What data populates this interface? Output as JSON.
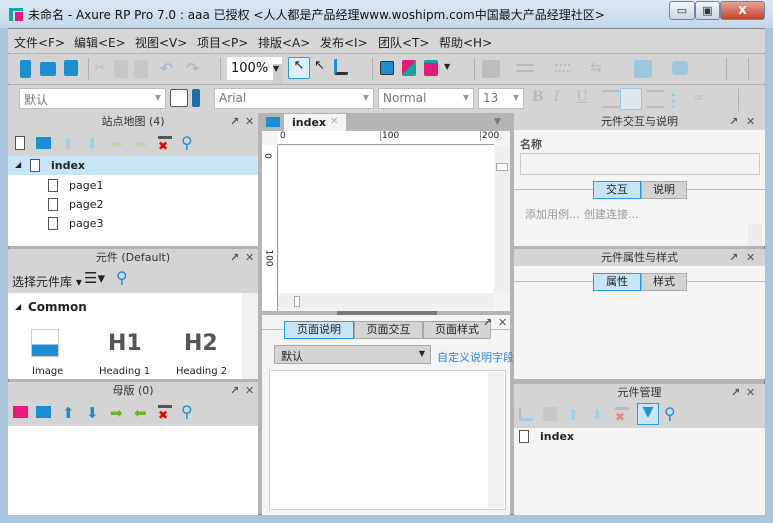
{
  "window": {
    "title": "未命名 - Axure RP Pro 7.0 : aaa 已授权     <人人都是产品经理www.woshipm.com中国最大产品经理社区>",
    "minimize": "▭",
    "maximize": "▣",
    "close": "X"
  },
  "menu": [
    "文件<F>",
    "编辑<E>",
    "视图<V>",
    "项目<P>",
    "排版<A>",
    "发布<I>",
    "团队<T>",
    "帮助<H>"
  ],
  "toolbar": {
    "zoom": "100%",
    "style_select": "默认",
    "font": "Arial",
    "weight": "Normal",
    "size": "13",
    "bold": "B",
    "italic": "I",
    "underline": "U"
  },
  "sitemap": {
    "title": "站点地图 (4)",
    "root": "index",
    "pages": [
      "page1",
      "page2",
      "page3"
    ]
  },
  "widgets": {
    "title": "元件 (Default)",
    "library_select": "选择元件库",
    "group": "Common",
    "items": [
      "Image",
      "Heading 1",
      "Heading 2"
    ],
    "h1": "H1",
    "h2": "H2"
  },
  "masters": {
    "title": "母版 (0)"
  },
  "canvas": {
    "tab": "index",
    "ruler_h": [
      "0",
      "100",
      "200"
    ],
    "ruler_v": [
      "0",
      "100"
    ]
  },
  "page_notes": {
    "tabs": [
      "页面说明",
      "页面交互",
      "页面样式"
    ],
    "select": "默认",
    "custom_link": "自定义说明字段"
  },
  "interactions": {
    "title": "元件交互与说明",
    "name_label": "名称",
    "name_value": "",
    "tabs": [
      "交互",
      "说明"
    ],
    "add_case": "添加用例...",
    "create_link": "创建连接..."
  },
  "properties": {
    "title": "元件属性与样式",
    "tabs": [
      "属性",
      "样式"
    ]
  },
  "manager": {
    "title": "元件管理",
    "item": "index"
  },
  "colors": {
    "accent": "#2a9bd7",
    "selected_row": "#c6e6f7",
    "brand_pink": "#e6197c",
    "brand_teal": "#14a6a0"
  }
}
